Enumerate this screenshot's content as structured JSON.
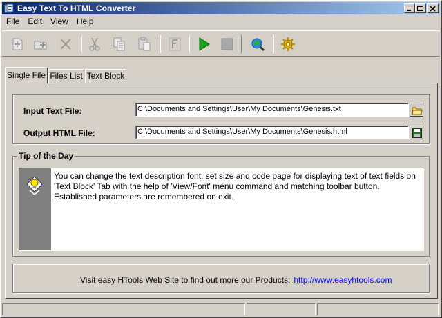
{
  "window": {
    "title": "Easy Text To HTML Converter"
  },
  "menu": [
    "File",
    "Edit",
    "View",
    "Help"
  ],
  "toolbar": {
    "buttons": [
      "new-icon",
      "open-icon",
      "delete-icon",
      "cut-icon",
      "copy-icon",
      "paste-icon",
      "font-icon",
      "run-icon",
      "stop-icon",
      "web-icon",
      "settings-icon"
    ]
  },
  "tabs": [
    "Single File",
    "Files List",
    "Text Block"
  ],
  "active_tab": "Single File",
  "form": {
    "input_label": "Input Text File:",
    "input_value": "C:\\Documents and Settings\\User\\My Documents\\Genesis.txt",
    "output_label": "Output HTML File:",
    "output_value": "C:\\Documents and Settings\\User\\My Documents\\Genesis.html"
  },
  "tip": {
    "title": "Tip of the Day",
    "text": "You can change the text description font, set size and code page for displaying text of text fields on 'Text Block' Tab with the help of 'View/Font' menu command and matching toolbar button. Established parameters are remembered on exit."
  },
  "footer": {
    "text": "Visit easy HTools Web Site to find out more our Products:",
    "link": "http://www.easyhtools.com"
  },
  "colors": {
    "titlebar_start": "#0a246a",
    "titlebar_end": "#a6caf0",
    "face": "#d4d0c8",
    "link": "#0000ff"
  }
}
